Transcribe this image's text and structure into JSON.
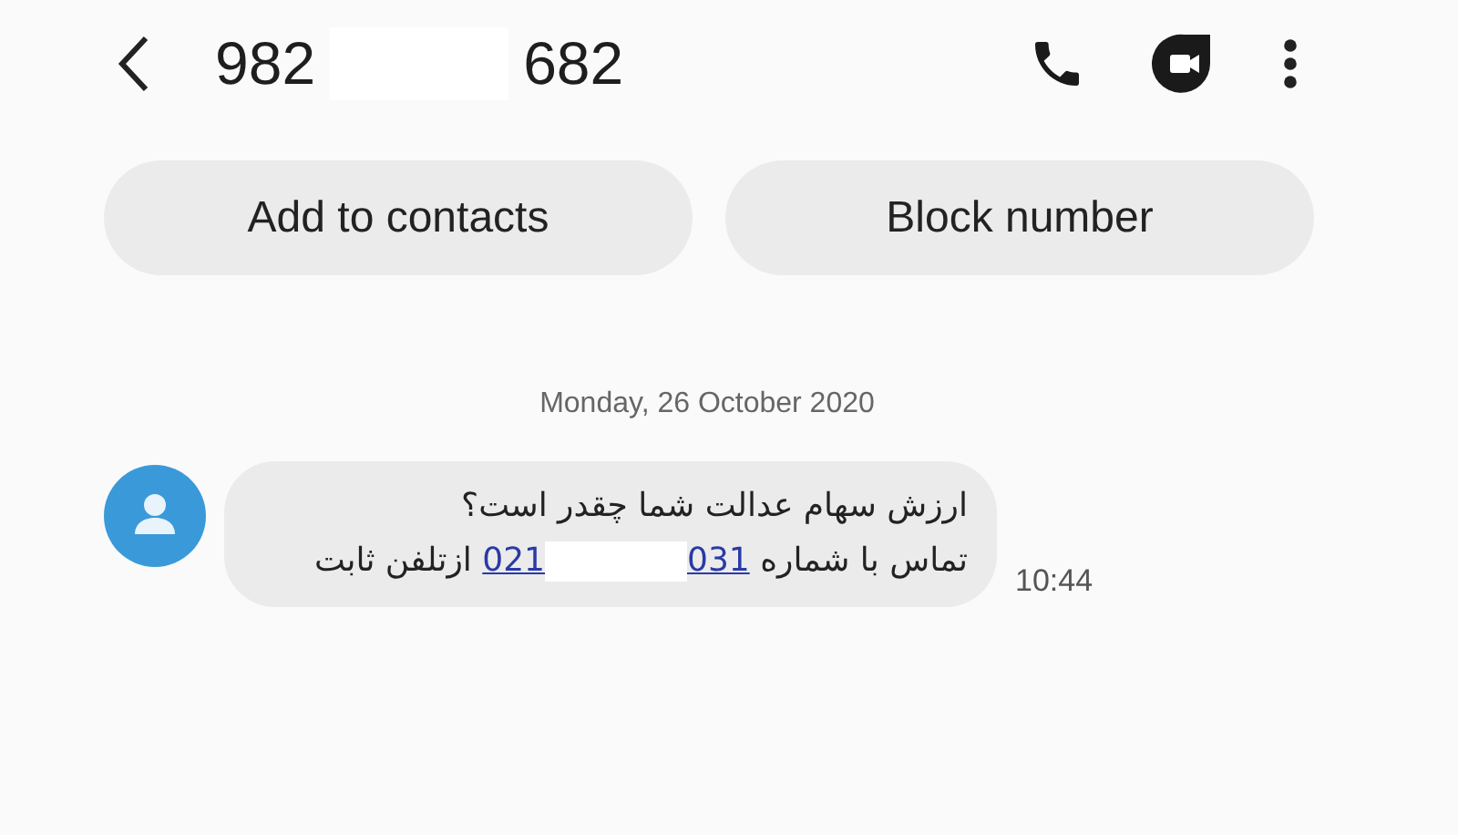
{
  "header": {
    "number_start": "982",
    "number_end": "682"
  },
  "actions": [
    "Add to contacts",
    "Block number"
  ],
  "date": "Monday, 26 October 2020",
  "message": {
    "line_1": "ارزش سهام عدالت شما چقدر است؟",
    "line_2_before": "تماس با شماره",
    "link_start": "021",
    "link_end": "031",
    "line_2_after": "ازتلفن ثابت",
    "time": "10:44"
  }
}
